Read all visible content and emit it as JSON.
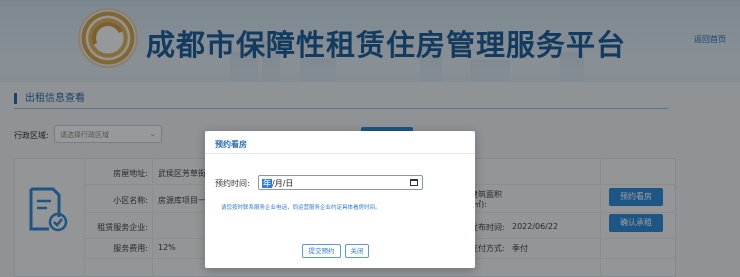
{
  "header": {
    "site_title": "成都市保障性租赁住房管理服务平台",
    "back_home": "返回首页"
  },
  "section": {
    "title": "出租信息查看"
  },
  "filter": {
    "district_label": "行政区域:",
    "district_placeholder": "请选择行政区域"
  },
  "listing": {
    "rows": [
      {
        "label": "房屋地址:",
        "value": "武侯区芳草街"
      },
      {
        "label": "小区名称:",
        "value": "房源库项目一"
      },
      {
        "label": "租赁服务企业:",
        "value": ""
      },
      {
        "label": "服务费用:",
        "value": "12%"
      }
    ],
    "right_rows": [
      {
        "label": "建筑面积(㎡):",
        "value": ""
      },
      {
        "label": "发布时间:",
        "value": "2022/06/22"
      },
      {
        "label": "支付方式:",
        "value": "季付"
      }
    ],
    "book_button": "预约看房",
    "confirm_button": "确认承租"
  },
  "modal": {
    "title": "预约看房",
    "time_label": "预约时间:",
    "date_year": "年",
    "date_rest": "/月/日",
    "notice": "请您按时联系服务企业电话，同运营服务企业约定具体看房时间。",
    "submit": "提交预约",
    "close": "关闭"
  },
  "colors": {
    "primary": "#2f8ad6",
    "title_blue": "#1f5f9c"
  }
}
